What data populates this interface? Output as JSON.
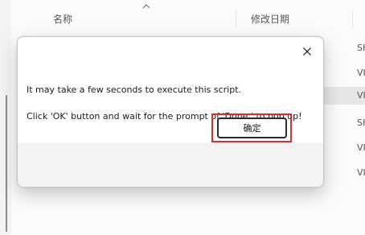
{
  "explorer": {
    "columns": {
      "name": "名称",
      "date": "修改日期",
      "type": "类"
    },
    "type_cells": [
      "SH",
      "VI",
      "VI",
      "SH",
      "VI",
      "VI"
    ]
  },
  "dialog": {
    "message_line1": "It may take a few seconds to execute this script.",
    "message_line2": "Click 'OK' button and wait for the prompt of 'Done.' to pop up!",
    "ok_label": "确定",
    "close_symbol": "✕"
  },
  "colors": {
    "highlight": "#e02b2b",
    "footer": "#f3f3f3"
  }
}
